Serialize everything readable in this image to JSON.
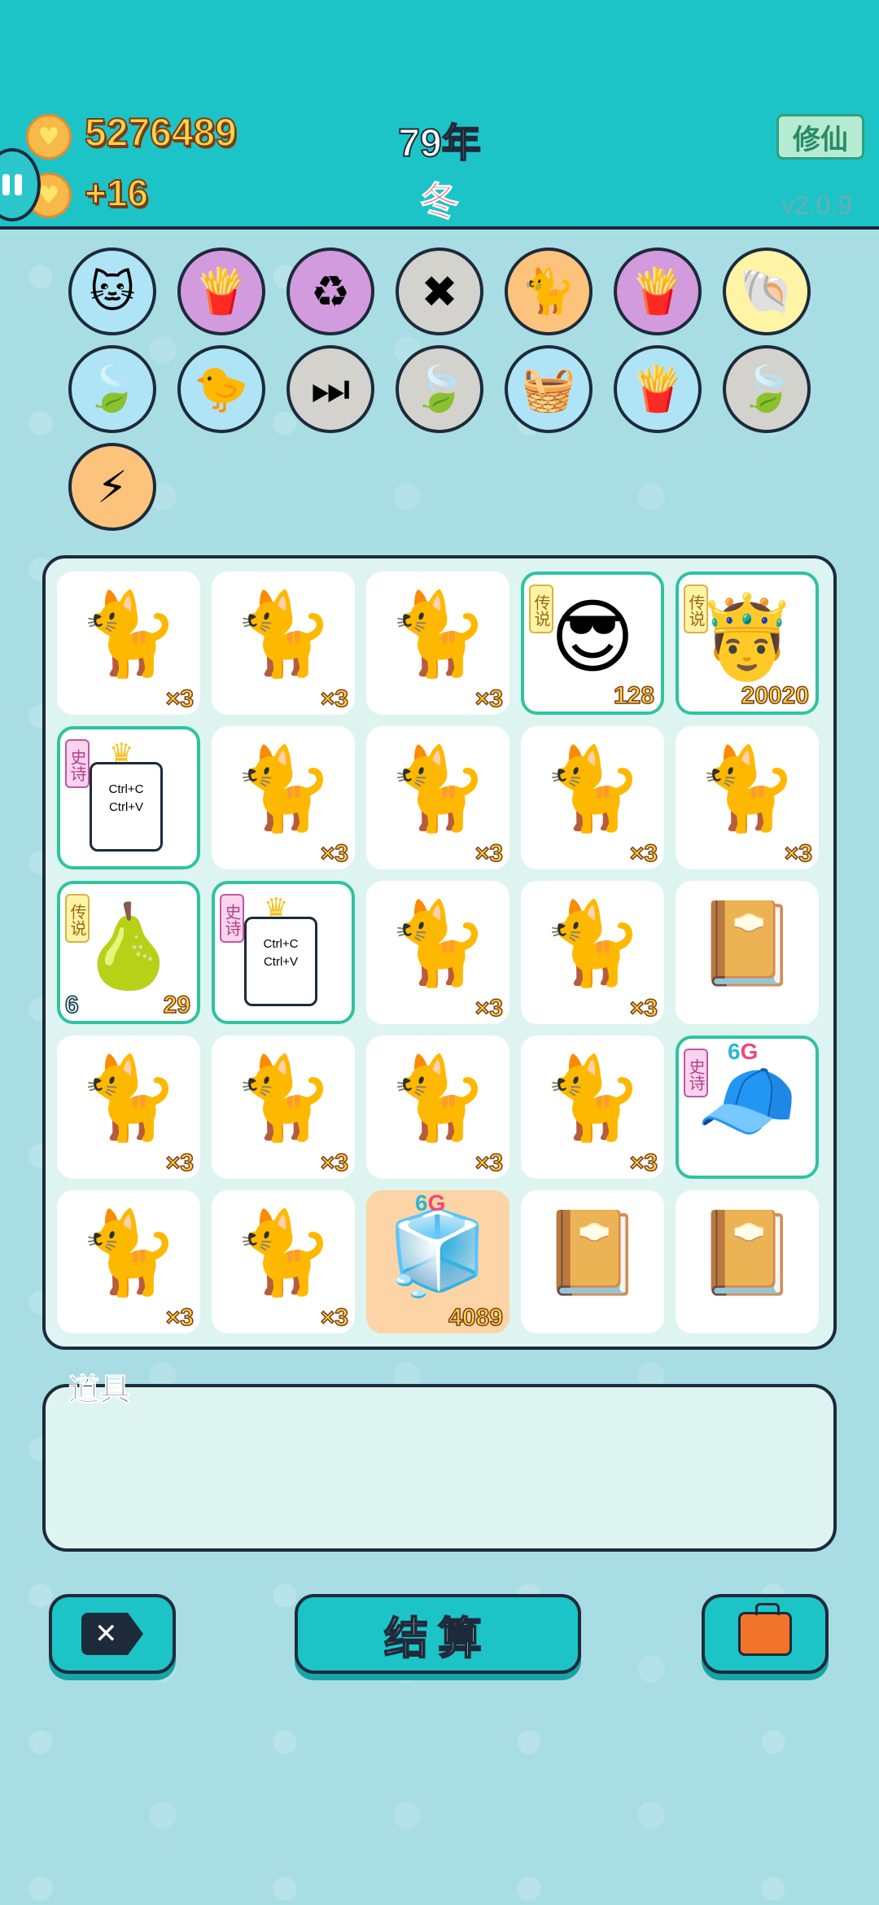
{
  "header": {
    "coins": "5276489",
    "income": "+16",
    "year": "79年",
    "season": "冬",
    "mode_button": "修仙",
    "version": "v2.0.9"
  },
  "effects": [
    {
      "icon": "cat-drink-icon",
      "color": "blue"
    },
    {
      "icon": "fries-icon",
      "color": "purple"
    },
    {
      "icon": "recycle-icon",
      "color": "purple"
    },
    {
      "icon": "delete-tag-icon",
      "color": "gray"
    },
    {
      "icon": "twin-cats-icon",
      "color": "orange"
    },
    {
      "icon": "fries-icon",
      "color": "purple"
    },
    {
      "icon": "shell-icon",
      "color": "yellow"
    },
    {
      "icon": "leaf-icon",
      "color": "blue"
    },
    {
      "icon": "chick-egg-icon",
      "color": "blue"
    },
    {
      "icon": "skip-icon",
      "color": "gray"
    },
    {
      "icon": "leaf-icon",
      "color": "gray"
    },
    {
      "icon": "fruit-basket-icon",
      "color": "blue"
    },
    {
      "icon": "fries-icon",
      "color": "blue"
    },
    {
      "icon": "leaf-icon",
      "color": "gray"
    },
    {
      "icon": "lightning-icon",
      "color": "orange"
    }
  ],
  "board": [
    [
      {
        "type": "cat",
        "count": "×3"
      },
      {
        "type": "cat",
        "count": "×3"
      },
      {
        "type": "cat",
        "count": "×3"
      },
      {
        "type": "sunglasses-man",
        "tag": "传说",
        "count": "128"
      },
      {
        "type": "crowned-old-man",
        "tag": "传说",
        "count": "20020"
      }
    ],
    [
      {
        "type": "copy-paste",
        "tag": "史诗",
        "copy": "Ctrl+C",
        "paste": "Ctrl+V"
      },
      {
        "type": "cat",
        "count": "×3"
      },
      {
        "type": "cat",
        "count": "×3"
      },
      {
        "type": "cat",
        "count": "×3"
      },
      {
        "type": "cat",
        "count": "×3"
      }
    ],
    [
      {
        "type": "pomelo",
        "tag": "传说",
        "left": "6",
        "count": "29"
      },
      {
        "type": "copy-paste",
        "tag": "史诗",
        "copy": "Ctrl+C",
        "paste": "Ctrl+V"
      },
      {
        "type": "cat",
        "count": "×3"
      },
      {
        "type": "cat",
        "count": "×3"
      },
      {
        "type": "book"
      }
    ],
    [
      {
        "type": "cat",
        "count": "×3"
      },
      {
        "type": "cat",
        "count": "×3"
      },
      {
        "type": "cat",
        "count": "×3"
      },
      {
        "type": "cat",
        "count": "×3"
      },
      {
        "type": "red-cap-boy",
        "tag": "史诗",
        "badge6": "6",
        "badgeG": "G"
      }
    ],
    [
      {
        "type": "cat",
        "count": "×3"
      },
      {
        "type": "cat",
        "count": "×3"
      },
      {
        "type": "fridge",
        "badge6": "6",
        "badgeG": "G",
        "count": "4089"
      },
      {
        "type": "book"
      },
      {
        "type": "book"
      }
    ]
  ],
  "items": {
    "label": "道具"
  },
  "buttons": {
    "settle": "结算"
  }
}
